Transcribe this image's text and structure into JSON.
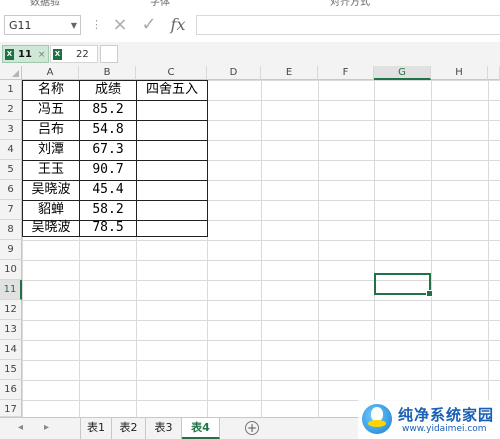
{
  "top_labels": [
    "数据验",
    "字体",
    "对齐方式"
  ],
  "formula_bar": {
    "name_box": "G11",
    "cancel_icon": "×",
    "enter_icon": "✓",
    "fx_label": "fx",
    "formula": ""
  },
  "workbook_tabs": [
    {
      "label": "11",
      "active": true
    },
    {
      "label": "22",
      "active": false
    }
  ],
  "columns": [
    "A",
    "B",
    "C",
    "D",
    "E",
    "F",
    "G",
    "H"
  ],
  "selected_column": "G",
  "rows": [
    "1",
    "2",
    "3",
    "4",
    "5",
    "6",
    "7",
    "8",
    "9",
    "10",
    "11",
    "12",
    "13",
    "14",
    "15",
    "16",
    "17"
  ],
  "selected_row": "11",
  "table": {
    "headers": [
      "名称",
      "成绩",
      "四舍五入"
    ],
    "rows": [
      [
        "冯五",
        "85.2",
        ""
      ],
      [
        "吕布",
        "54.8",
        ""
      ],
      [
        "刘潭",
        "67.3",
        ""
      ],
      [
        "王玉",
        "90.7",
        ""
      ],
      [
        "吴晓波",
        "45.4",
        ""
      ],
      [
        "貂蝉",
        "58.2",
        ""
      ],
      [
        "吴晓波",
        "78.5",
        ""
      ]
    ]
  },
  "sheet_tabs": [
    {
      "label": "表1",
      "active": false
    },
    {
      "label": "表2",
      "active": false
    },
    {
      "label": "表3",
      "active": false
    },
    {
      "label": "表4",
      "active": true
    }
  ],
  "add_sheet": "+",
  "watermark": {
    "title": "纯净系统家园",
    "url": "www.yidaimei.com"
  },
  "colors": {
    "accent": "#217346",
    "tab_active_bg": "#cfe7d6"
  }
}
